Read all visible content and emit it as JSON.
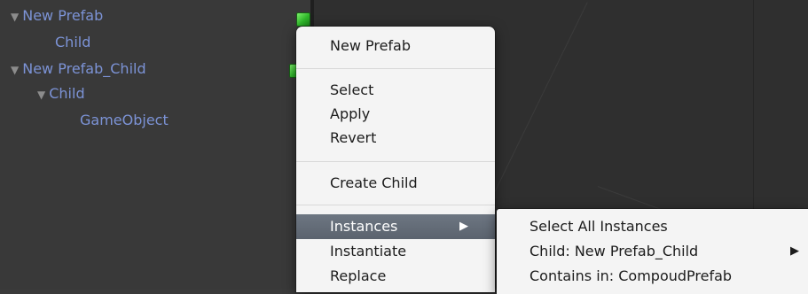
{
  "hierarchy": {
    "items": [
      {
        "label": "New Prefab",
        "expanded": true
      },
      {
        "label": "Child"
      },
      {
        "label": "New Prefab_Child",
        "expanded": true
      },
      {
        "label": "Child",
        "expanded": true
      },
      {
        "label": "GameObject"
      }
    ],
    "arrow_glyph": "▼"
  },
  "context_menu": {
    "header": "New Prefab",
    "items": {
      "select": "Select",
      "apply": "Apply",
      "revert": "Revert",
      "create_child": "Create Child",
      "instances": "Instances",
      "instantiate": "Instantiate",
      "replace": "Replace"
    },
    "submenu_arrow": "▶"
  },
  "instances_submenu": {
    "select_all": "Select All Instances",
    "child": "Child: New Prefab_Child",
    "contains_in": "Contains in: CompoudPrefab",
    "submenu_arrow": "▶"
  },
  "colors": {
    "prefab_text": "#7c93d6",
    "highlight": "#5b636e",
    "menu_bg": "#f4f4f4",
    "prefab_icon": "#2fb82a"
  }
}
